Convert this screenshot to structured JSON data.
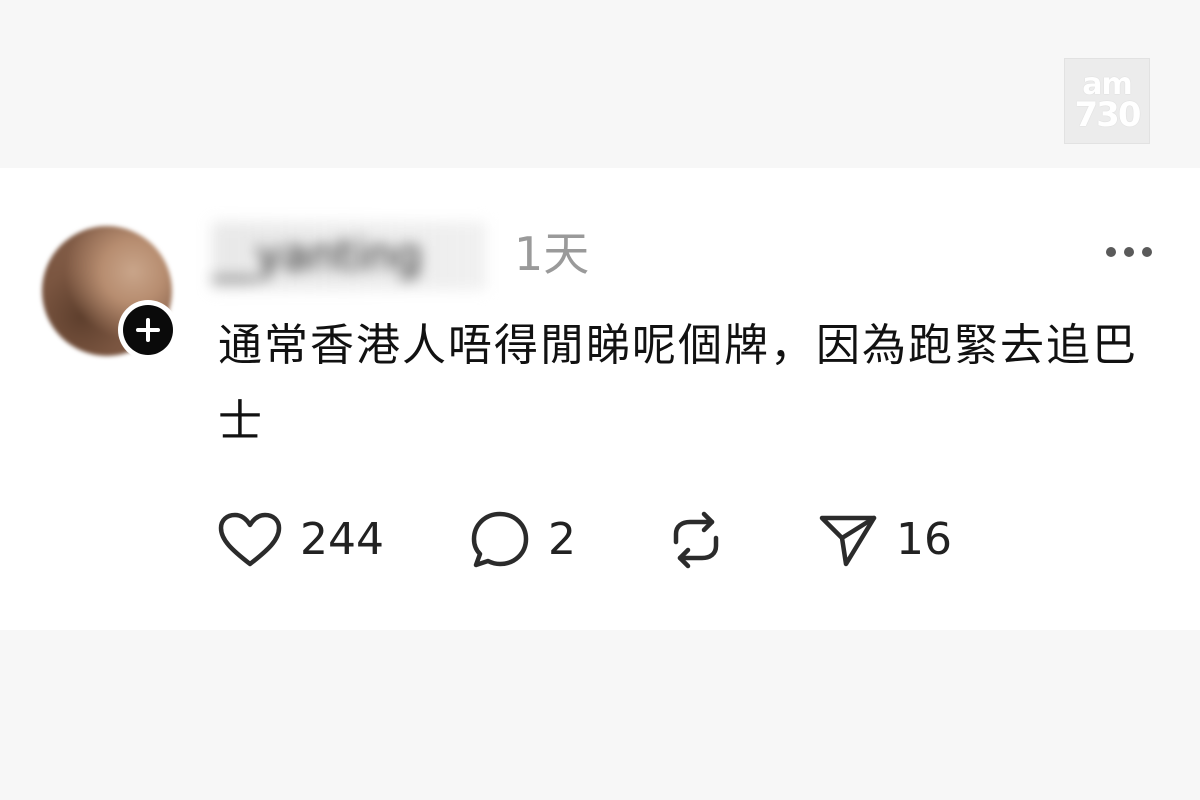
{
  "watermark": {
    "line1": "am",
    "line2": "730"
  },
  "post": {
    "username": "__yanting",
    "time_ago": "1天",
    "text": "通常香港人唔得閒睇呢個牌，因為跑緊去追巴士",
    "actions": {
      "likes": "244",
      "replies": "2",
      "reposts": "",
      "shares": "16"
    }
  },
  "icons": [
    "plus-icon",
    "more-icon",
    "heart-icon",
    "comment-icon",
    "repost-icon",
    "share-icon"
  ]
}
